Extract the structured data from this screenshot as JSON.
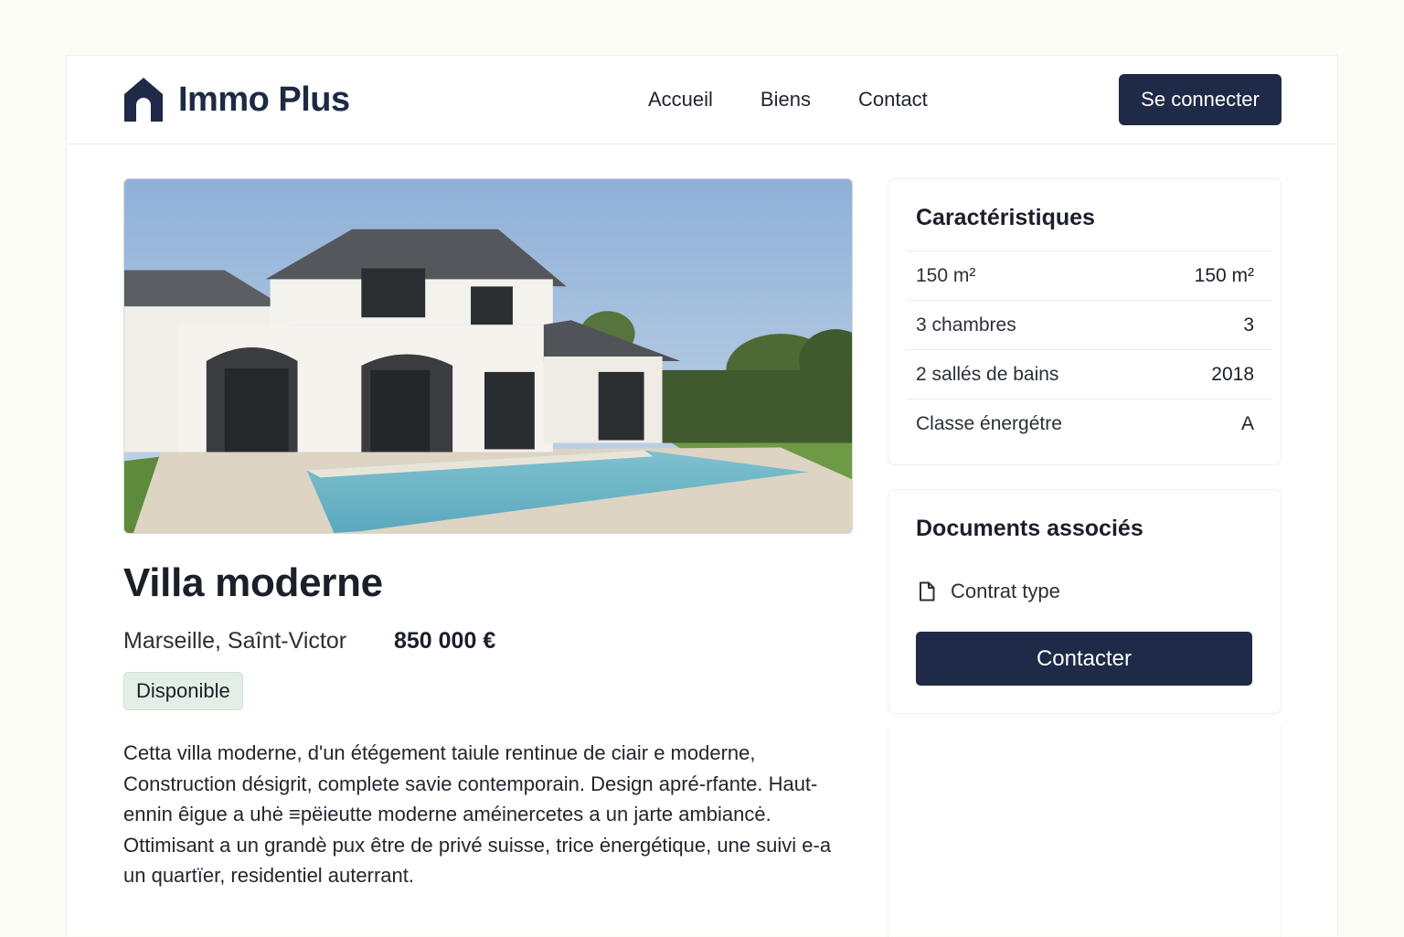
{
  "header": {
    "brand": "Immo Plus",
    "nav": [
      "Accueil",
      "Biens",
      "Contact"
    ],
    "login_label": "Se connecter"
  },
  "listing": {
    "title": "Villa moderne",
    "location": "Marseille, Saînt-Victor",
    "price": "850 000 €",
    "status": "Disponible",
    "description": "Cetta villa moderne, d'un étégement taiule rentinue de ciair e moderne, Construction désigrit, complete savie contemporain. Design apré-rfante. Haut-ennin êigue a uhė ≡pëieutte moderne améinercetes a un jarte ambiancė. Ottimisant a un grandè pux être de privé suisse, trice ėnergétique, une suivi e-a un quartïer, residentiel auterrant."
  },
  "specs": {
    "title": "Caractéristiques",
    "rows": [
      {
        "label": "150 m²",
        "value": "150 m²"
      },
      {
        "label": "3 chambres",
        "value": "3"
      },
      {
        "label": "2 sallés de bains",
        "value": "2018"
      },
      {
        "label": "Classe énergétre",
        "value": "A"
      }
    ]
  },
  "documents": {
    "title": "Documents associés",
    "items": [
      {
        "label": "Contrat type",
        "icon": "document-icon"
      }
    ],
    "contact_label": "Contacter"
  },
  "colors": {
    "brand_navy": "#1e2a47",
    "badge_bg": "#e3efe6",
    "page_bg": "#fcfcf7"
  }
}
